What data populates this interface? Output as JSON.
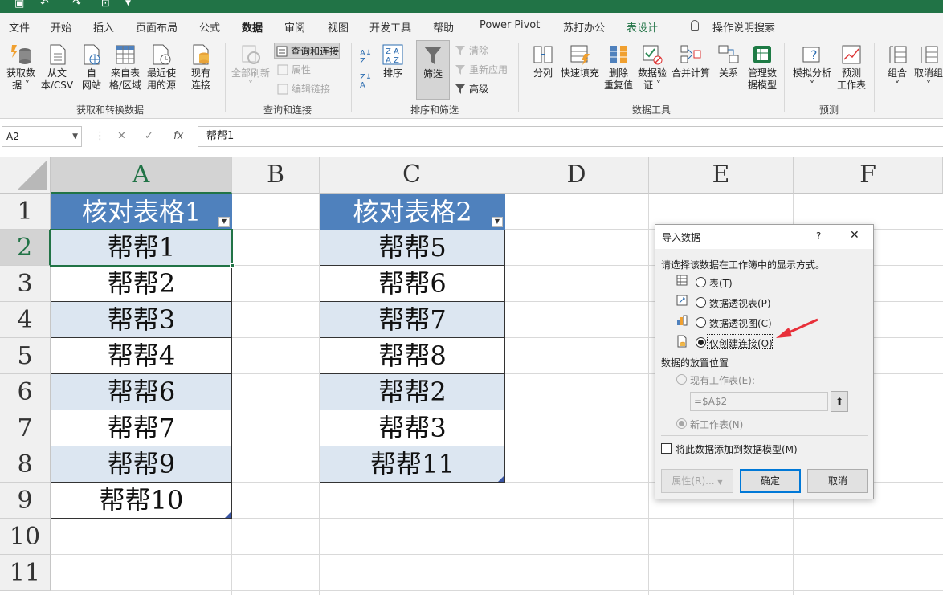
{
  "ribbon_tabs": [
    {
      "label": "文件"
    },
    {
      "label": "开始"
    },
    {
      "label": "插入"
    },
    {
      "label": "页面布局"
    },
    {
      "label": "公式"
    },
    {
      "label": "数据",
      "active": true
    },
    {
      "label": "审阅"
    },
    {
      "label": "视图"
    },
    {
      "label": "开发工具"
    },
    {
      "label": "帮助"
    },
    {
      "label": "Power Pivot"
    },
    {
      "label": "苏打办公"
    },
    {
      "label": "表设计",
      "contextual": true
    }
  ],
  "tell_me": "操作说明搜索",
  "ribbon": {
    "get_transform": {
      "group_label": "获取和转换数据",
      "get_data_1": "获取数",
      "get_data_2": "据 ˅",
      "from_text_1": "从文",
      "from_text_2": "本/CSV",
      "from_web_1": "自",
      "from_web_2": "网站",
      "from_table_1": "来自表",
      "from_table_2": "格/区域",
      "recent_1": "最近使",
      "recent_2": "用的源",
      "existing_1": "现有",
      "existing_2": "连接"
    },
    "queries": {
      "group_label": "查询和连接",
      "refresh_all": "全部刷新",
      "refresh_arrow": "˅",
      "queries_connections": "查询和连接",
      "properties": "属性",
      "edit_links": "编辑链接"
    },
    "sort_filter": {
      "group_label": "排序和筛选",
      "sort": "排序",
      "filter": "筛选",
      "clear": "清除",
      "reapply": "重新应用",
      "advanced": "高级"
    },
    "data_tools": {
      "group_label": "数据工具",
      "text_to_columns": "分列",
      "flash_fill": "快速填充",
      "remove_dup_1": "删除",
      "remove_dup_2": "重复值",
      "validation_1": "数据验",
      "validation_2": "证 ˅",
      "consolidate": "合并计算",
      "relationships": "关系",
      "manage_model_1": "管理数",
      "manage_model_2": "据模型"
    },
    "forecast": {
      "group_label": "预测",
      "whatif_1": "模拟分析",
      "whatif_2": "˅",
      "sheet_1": "预测",
      "sheet_2": "工作表"
    },
    "outline": {
      "group_1": "组合",
      "group_2": "˅",
      "ungroup_1": "取消组",
      "ungroup_2": "˅"
    }
  },
  "formula_bar": {
    "name_box": "A2",
    "content": "帮帮1"
  },
  "columns": [
    "A",
    "B",
    "C",
    "D",
    "E",
    "F"
  ],
  "rows": [
    "1",
    "2",
    "3",
    "4",
    "5",
    "6",
    "7",
    "8",
    "9",
    "10",
    "11"
  ],
  "table1": {
    "header": "核对表格1",
    "values": [
      "帮帮1",
      "帮帮2",
      "帮帮3",
      "帮帮4",
      "帮帮6",
      "帮帮7",
      "帮帮9",
      "帮帮10"
    ]
  },
  "table2": {
    "header": "核对表格2",
    "values": [
      "帮帮5",
      "帮帮6",
      "帮帮7",
      "帮帮8",
      "帮帮2",
      "帮帮3",
      "帮帮11"
    ]
  },
  "dialog": {
    "title": "导入数据",
    "help": "?",
    "close": "✕",
    "prompt": "请选择该数据在工作簿中的显示方式。",
    "view_options": [
      {
        "label": "表(T)",
        "checked": false
      },
      {
        "label": "数据透视表(P)",
        "checked": false
      },
      {
        "label": "数据透视图(C)",
        "checked": false
      },
      {
        "label": "仅创建连接(O)",
        "checked": true
      }
    ],
    "location_label": "数据的放置位置",
    "existing_sheet": "现有工作表(E):",
    "range_value": "=$A$2",
    "new_sheet": "新工作表(N)",
    "add_to_model": "将此数据添加到数据模型(M)",
    "properties_button": "属性(R)...",
    "ok_button": "确定",
    "cancel_button": "取消"
  },
  "annotation_color": "#e8303a",
  "accent_color": "#217346",
  "table_header_color": "#4f81bd",
  "table_band_color": "#dce6f1"
}
